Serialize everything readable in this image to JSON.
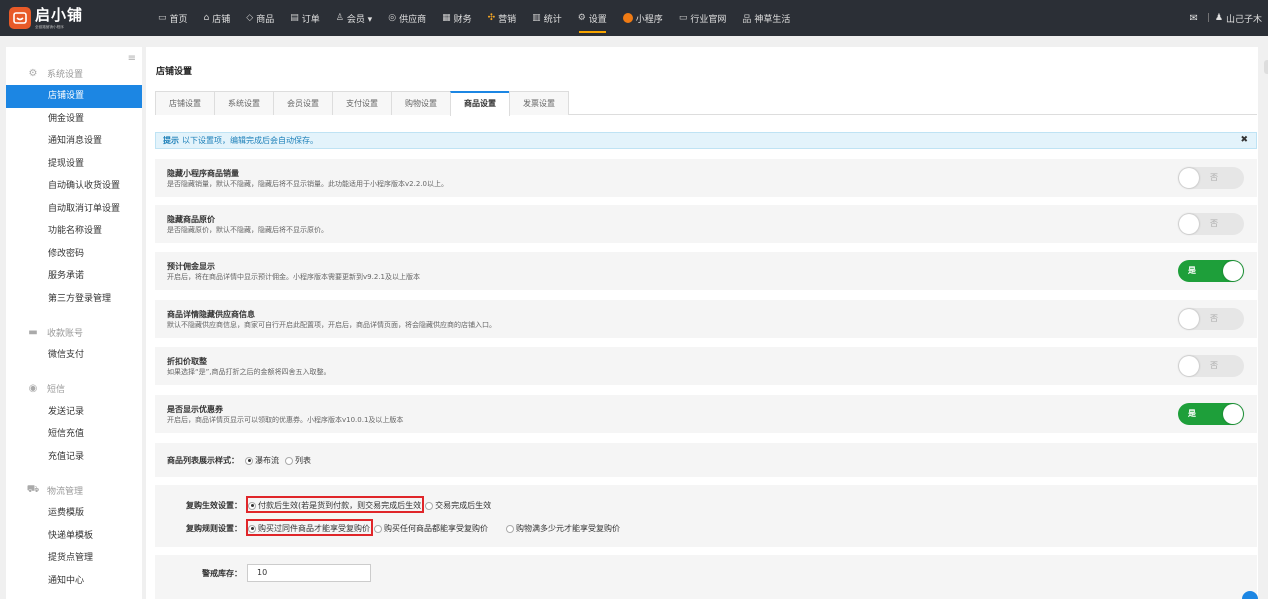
{
  "brand": {
    "title": "启小铺",
    "subtitle": "全链路营销小程序"
  },
  "nav": [
    {
      "icon": "home-icon",
      "glyph": "▭",
      "label": "首页"
    },
    {
      "icon": "store-icon",
      "glyph": "⌂",
      "label": "店铺"
    },
    {
      "icon": "tag-icon",
      "glyph": "◇",
      "label": "商品"
    },
    {
      "icon": "order-icon",
      "glyph": "▤",
      "label": "订单"
    },
    {
      "icon": "member-icon",
      "glyph": "♙",
      "label": "会员 ▾"
    },
    {
      "icon": "supplier-icon",
      "glyph": "◎",
      "label": "供应商"
    },
    {
      "icon": "finance-icon",
      "glyph": "▦",
      "label": "财务"
    },
    {
      "icon": "marketing-icon",
      "glyph": "✣",
      "label": "营销"
    },
    {
      "icon": "stats-icon",
      "glyph": "▥",
      "label": "统计"
    },
    {
      "icon": "settings-icon",
      "glyph": "⚙",
      "label": "设置"
    },
    {
      "icon": "miniprogram-icon",
      "glyph": "",
      "label": "小程序"
    },
    {
      "icon": "industry-icon",
      "glyph": "▭",
      "label": "行业官网"
    },
    {
      "icon": "life-icon",
      "glyph": "品",
      "label": "神草生活"
    }
  ],
  "user": {
    "name": "山己子木"
  },
  "sidebar": {
    "groups": [
      {
        "icon": "gear-icon",
        "glyph": "⚙",
        "label": "系统设置",
        "items": [
          "店铺设置",
          "佣金设置",
          "通知消息设置",
          "提现设置",
          "自动确认收货设置",
          "自动取消订单设置",
          "功能名称设置",
          "修改密码",
          "服务承诺",
          "第三方登录管理"
        ]
      },
      {
        "icon": "card-icon",
        "glyph": "▬",
        "label": "收款账号",
        "items": [
          "微信支付"
        ]
      },
      {
        "icon": "sms-icon",
        "glyph": "◉",
        "label": "短信",
        "items": [
          "发送记录",
          "短信充值",
          "充值记录"
        ]
      },
      {
        "icon": "truck-icon",
        "glyph": "⛟",
        "label": "物流管理",
        "items": [
          "运费模版",
          "快递单模板",
          "提货点管理",
          "通知中心"
        ]
      }
    ]
  },
  "page": {
    "title": "店铺设置",
    "tabs": [
      "店铺设置",
      "系统设置",
      "会员设置",
      "支付设置",
      "购物设置",
      "商品设置",
      "发票设置"
    ],
    "tip_label": "提示",
    "tip_text": "以下设置项，编辑完成后会自动保存。",
    "tip_close": "✖"
  },
  "settings": [
    {
      "title": "隐藏小程序商品销量",
      "desc": "是否隐藏销量，默认不隐藏，隐藏后将不显示销量。此功能适用于小程序版本v2.2.0以上。",
      "state": "否"
    },
    {
      "title": "隐藏商品原价",
      "desc": "是否隐藏原价，默认不隐藏，隐藏后将不显示原价。",
      "state": "否"
    },
    {
      "title": "预计佣金显示",
      "desc": "开启后，将在商品详情中显示预计佣金。小程序版本需要更新到v9.2.1及以上版本",
      "state": "是"
    },
    {
      "title": "商品详情隐藏供应商信息",
      "desc": "默认不隐藏供应商信息，商家可自行开启此配置项，开启后，商品详情页面，将会隐藏供应商的店铺入口。",
      "state": "否"
    },
    {
      "title": "折扣价取整",
      "desc": "如果选择“是”,商品打折之后的金额将四舍五入取整。",
      "state": "否"
    },
    {
      "title": "是否显示优惠券",
      "desc": "开启后，商品详情页显示可以领取的优惠券。小程序版本v10.0.1及以上版本",
      "state": "是"
    }
  ],
  "list_style": {
    "label": "商品列表展示样式：",
    "options": [
      "瀑布流",
      "列表"
    ]
  },
  "repurchase_effect": {
    "label": "复购生效设置：",
    "options": [
      "付款后生效(若是货到付款，则交易完成后生效",
      "交易完成后生效"
    ]
  },
  "repurchase_rule": {
    "label": "复购规则设置：",
    "options": [
      "购买过同件商品才能享受复购价",
      "购买任何商品都能享受复购价",
      "购物满多少元才能享受复购价"
    ]
  },
  "stock": {
    "label": "警戒库存：",
    "value": "10"
  }
}
